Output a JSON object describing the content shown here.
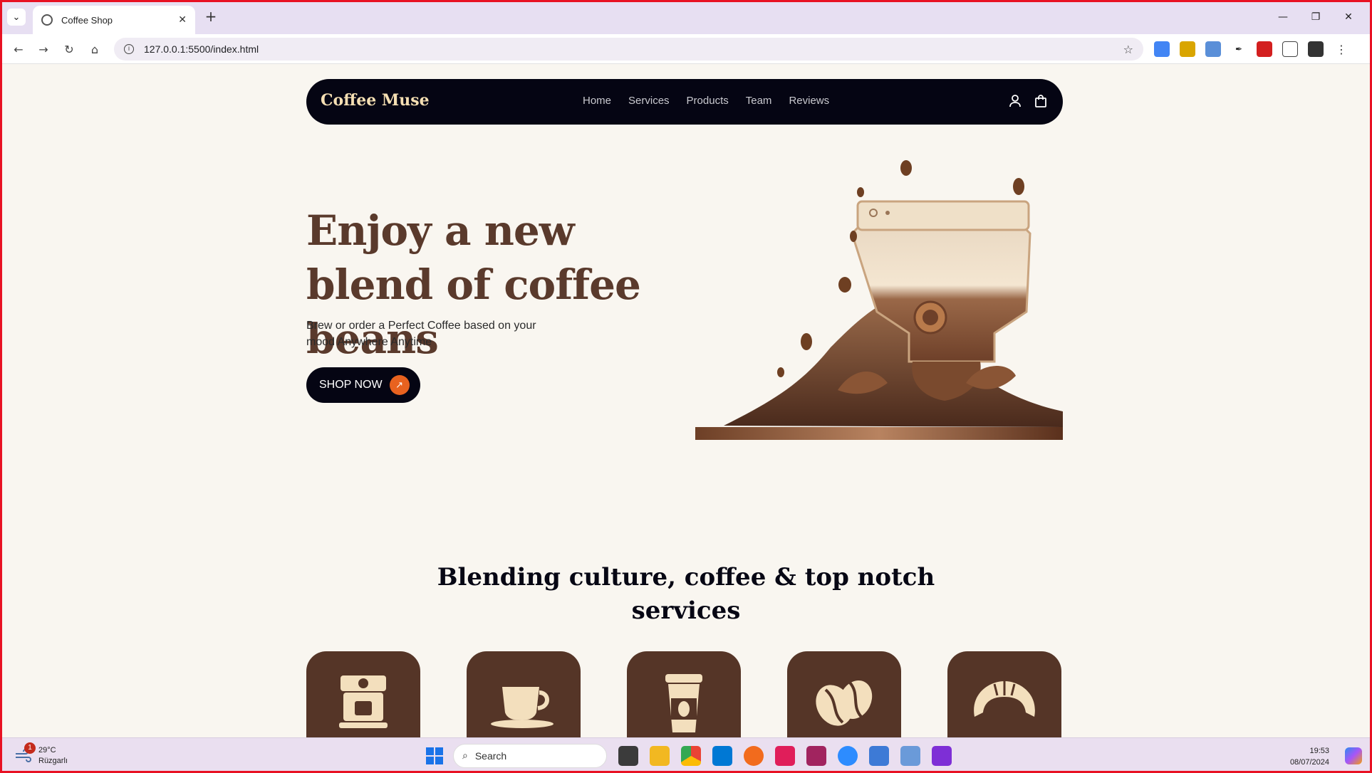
{
  "browser": {
    "tab_title": "Coffee Shop",
    "tab_list_glyph": "⌄",
    "tab_close_glyph": "✕",
    "new_tab_glyph": "+",
    "url": "127.0.0.1:5500/index.html",
    "window_controls": [
      "—",
      "❐",
      "✕"
    ],
    "nav": {
      "back": "←",
      "forward": "→",
      "reload": "↻",
      "home": "⌂",
      "star": "☆",
      "menu": "⋮"
    }
  },
  "site": {
    "logo": "Coffee Muse",
    "nav_links": [
      "Home",
      "Services",
      "Products",
      "Team",
      "Reviews"
    ],
    "hero": {
      "title": "Enjoy a new blend of coffee beans",
      "subtitle": "Brew or order a Perfect Coffee based on your mood Anywhere Anytime",
      "cta": "SHOP NOW",
      "cta_arrow": "↗"
    },
    "services_title": "Blending culture, coffee & top notch services",
    "services_icons": [
      "espresso-machine-icon",
      "coffee-cup-icon",
      "takeaway-cup-icon",
      "coffee-bean-icon",
      "croissant-icon"
    ]
  },
  "colors": {
    "navbar": "#050513",
    "logo": "#f5dfb3",
    "hero_title": "#5a3a2c",
    "accent": "#e8621f",
    "card": "#553527",
    "card_icon": "#f3dfbd",
    "page_bg": "#f9f6f0"
  },
  "taskbar": {
    "weather_temp": "29°C",
    "weather_desc": "Rüzgarlı",
    "weather_badge": "1",
    "search_placeholder": "Search",
    "time": "19:53",
    "date": "08/07/2024"
  }
}
